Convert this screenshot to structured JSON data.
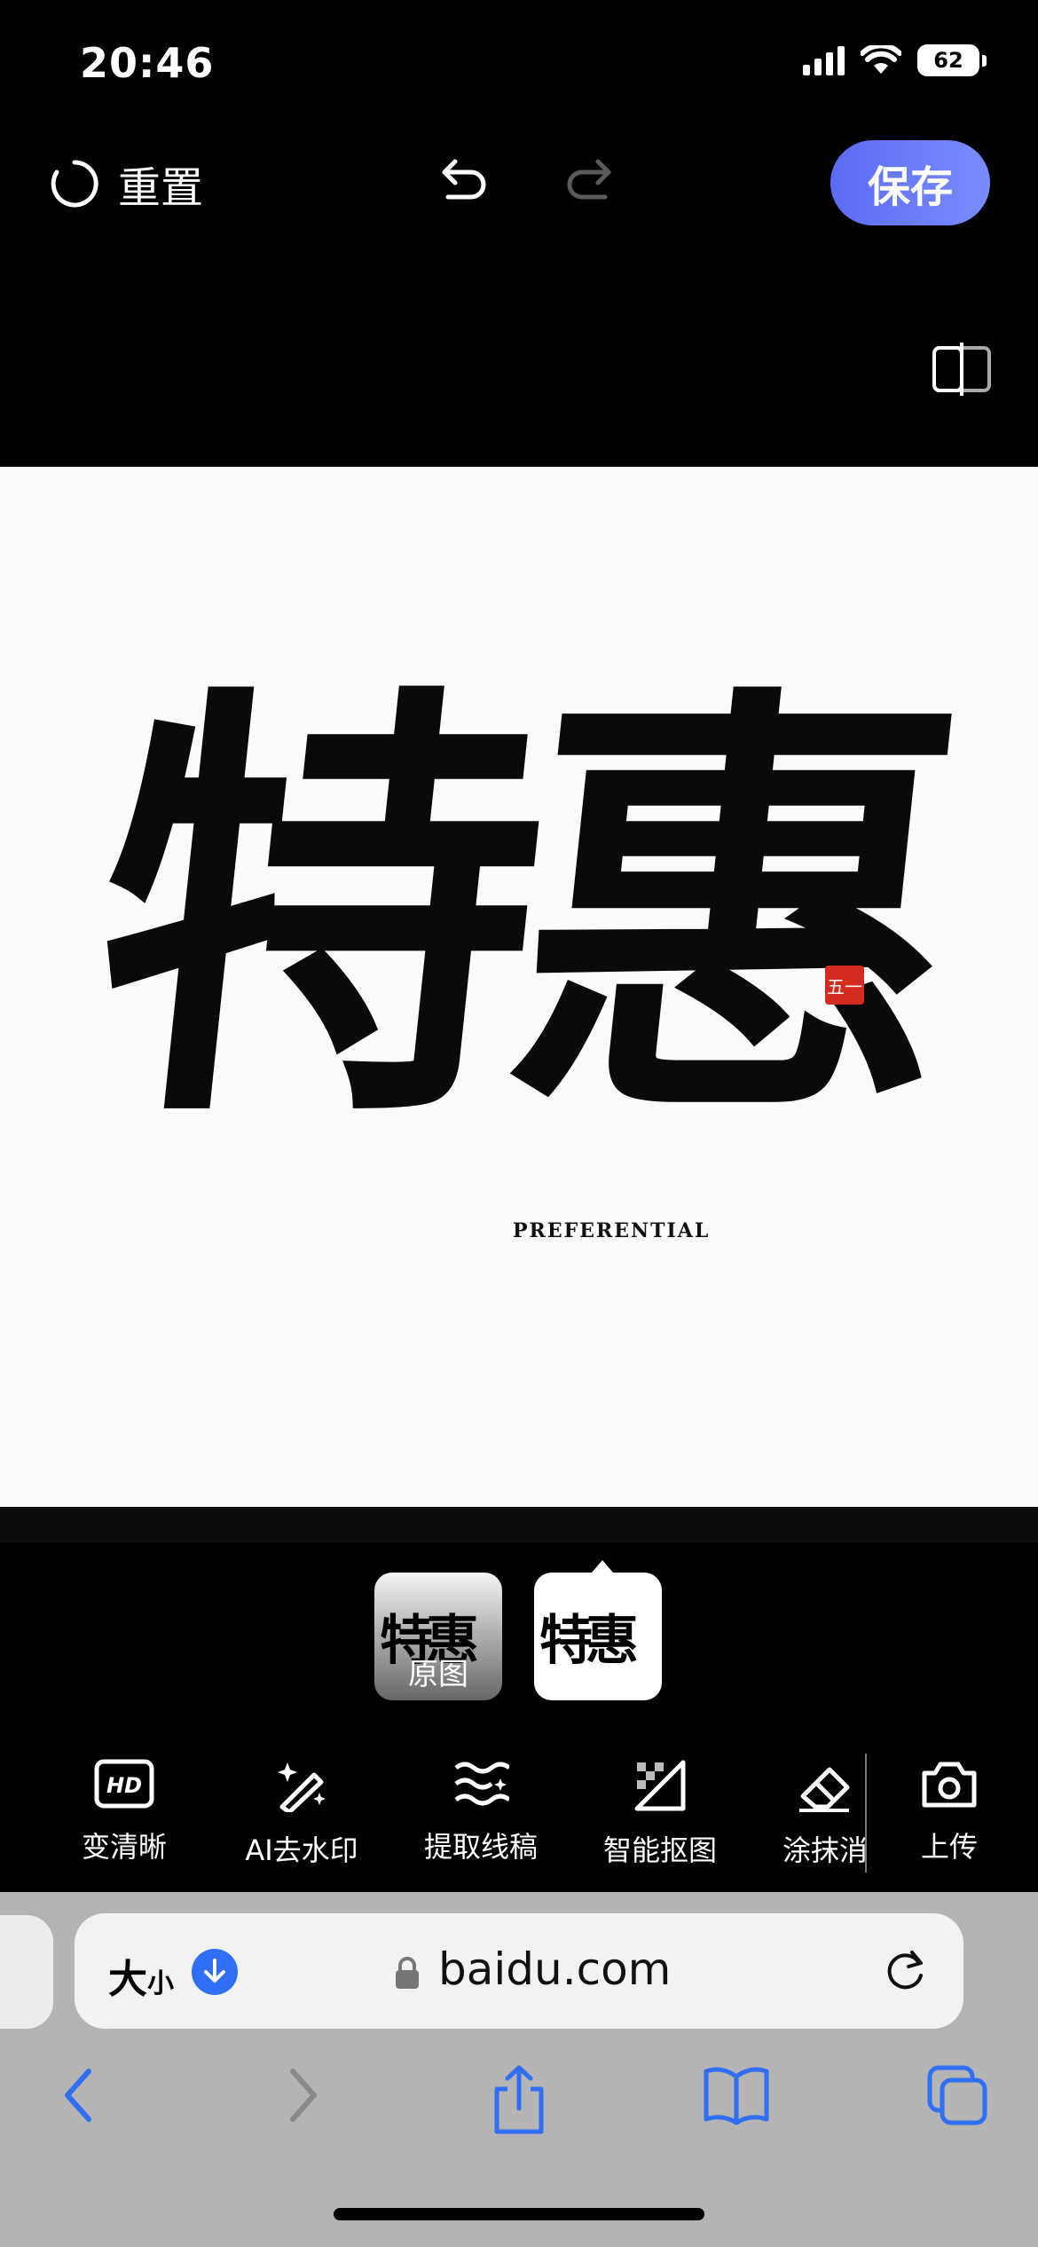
{
  "status": {
    "time": "20:46",
    "battery": "62"
  },
  "toolbar": {
    "reset_label": "重置",
    "save_label": "保存"
  },
  "canvas": {
    "sub_text": "PREFERENTIAL",
    "seal_text": "五一",
    "main_glyphs": "特惠"
  },
  "thumbnails": {
    "original_label": "原图",
    "glyphs": "特惠"
  },
  "tools": [
    {
      "label": "变清晰",
      "icon": "hd-icon"
    },
    {
      "label": "AI去水印",
      "icon": "magic-wand-icon"
    },
    {
      "label": "提取线稿",
      "icon": "line-extract-icon"
    },
    {
      "label": "智能抠图",
      "icon": "cutout-icon"
    },
    {
      "label": "涂抹消",
      "icon": "eraser-icon"
    },
    {
      "label": "上传",
      "icon": "camera-icon"
    }
  ],
  "browser": {
    "size_label": "大",
    "size_small": "小",
    "url": "baidu.com"
  },
  "colors": {
    "accent": "#5b6cf6",
    "link_blue": "#2f6ef5",
    "seal_red": "#d52b1e"
  }
}
